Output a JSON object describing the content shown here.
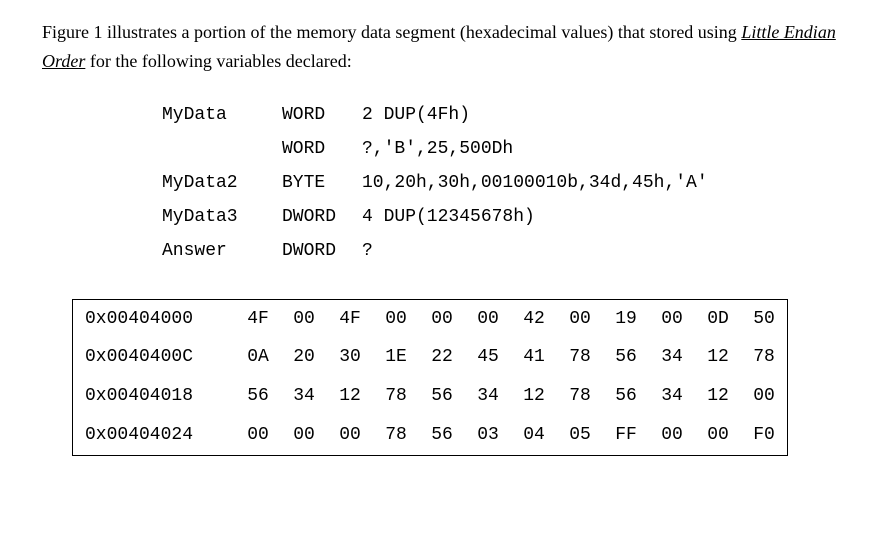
{
  "intro": {
    "prefix": "Figure 1 illustrates a portion of the memory data segment (hexadecimal values) that stored using ",
    "italic_underline": "Little Endian Order",
    "suffix": " for the following variables declared:"
  },
  "declarations": [
    {
      "name": "MyData",
      "type": "WORD",
      "args": "2 DUP(4Fh)"
    },
    {
      "name": "",
      "type": "WORD",
      "args": "?,'B',25,500Dh"
    },
    {
      "name": "MyData2",
      "type": "BYTE",
      "args": "10,20h,30h,00100010b,34d,45h,'A'"
    },
    {
      "name": "MyData3",
      "type": "DWORD",
      "args": "4 DUP(12345678h)"
    },
    {
      "name": "Answer",
      "type": "DWORD",
      "args": "?"
    }
  ],
  "memory": {
    "rows": [
      {
        "addr": "0x00404000",
        "bytes": [
          "4F",
          "00",
          "4F",
          "00",
          "00",
          "00",
          "42",
          "00",
          "19",
          "00",
          "0D",
          "50"
        ]
      },
      {
        "addr": "0x0040400C",
        "bytes": [
          "0A",
          "20",
          "30",
          "1E",
          "22",
          "45",
          "41",
          "78",
          "56",
          "34",
          "12",
          "78"
        ]
      },
      {
        "addr": "0x00404018",
        "bytes": [
          "56",
          "34",
          "12",
          "78",
          "56",
          "34",
          "12",
          "78",
          "56",
          "34",
          "12",
          "00"
        ]
      },
      {
        "addr": "0x00404024",
        "bytes": [
          "00",
          "00",
          "00",
          "78",
          "56",
          "03",
          "04",
          "05",
          "FF",
          "00",
          "00",
          "F0"
        ]
      }
    ]
  }
}
